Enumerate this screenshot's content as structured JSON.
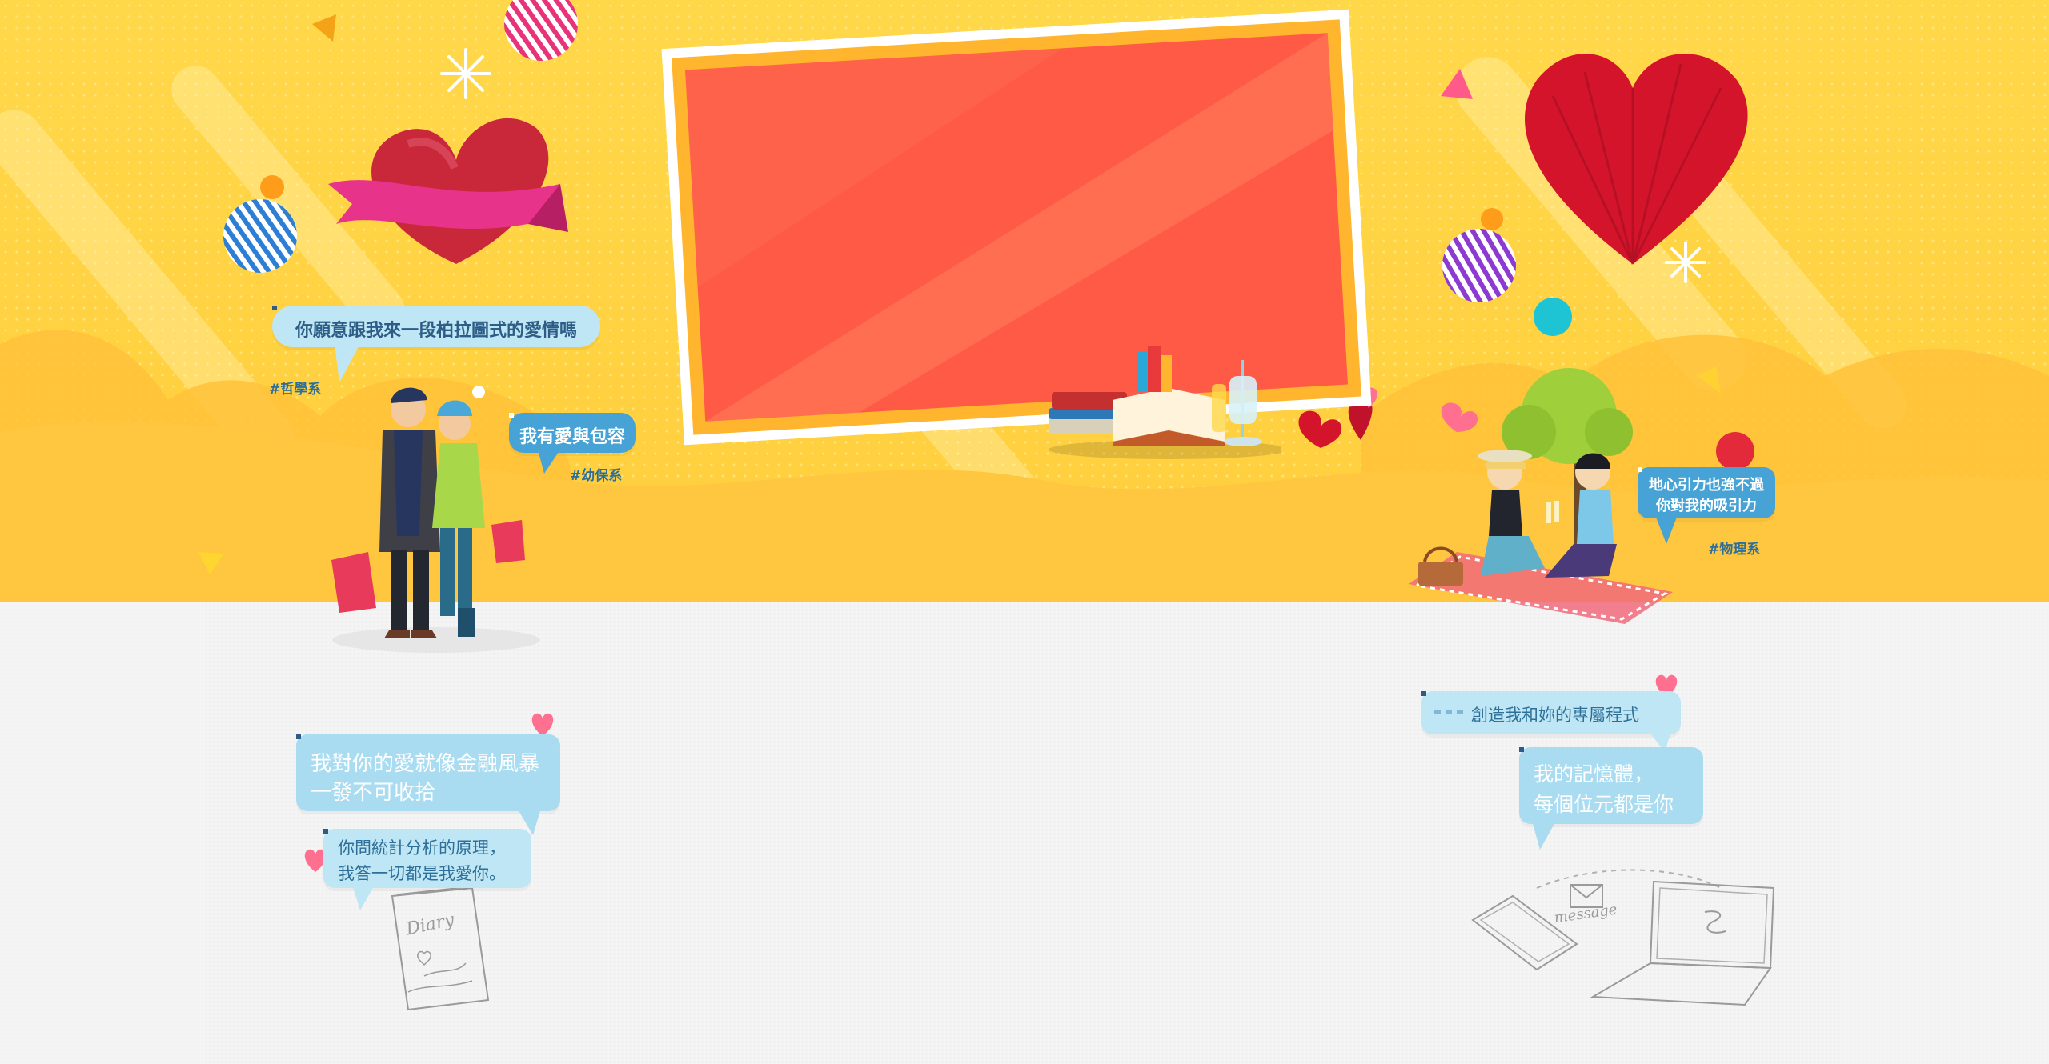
{
  "bubbles": {
    "philosophy_line": "你願意跟我來一段柏拉圖式的愛情嗎",
    "philosophy_tag": "#哲學系",
    "preschool_line": "我有愛與包容",
    "preschool_tag": "#幼保系",
    "physics_line_1": "地心引力也強不過",
    "physics_line_2": "你對我的吸引力",
    "physics_tag": "#物理系",
    "finance_line_1": "我對你的愛就像金融風暴",
    "finance_line_2": "一發不可收拾",
    "stats_line_1": "你問統計分析的原理，",
    "stats_line_2": "我答一切都是我愛你。",
    "program_line": "創造我和妳的專屬程式",
    "memory_line_1": "我的記憶體，",
    "memory_line_2": "每個位元都是你"
  },
  "doodles": {
    "diary_label": "Diary",
    "message_label": "message"
  },
  "colors": {
    "background_yellow": "#ffd84a",
    "board_red": "#ff5a46",
    "board_frame_orange": "#ffb52e",
    "bubble_blue": "#47a3d6",
    "bubble_light": "#bfe6f4",
    "heart_red": "#d4142a"
  }
}
